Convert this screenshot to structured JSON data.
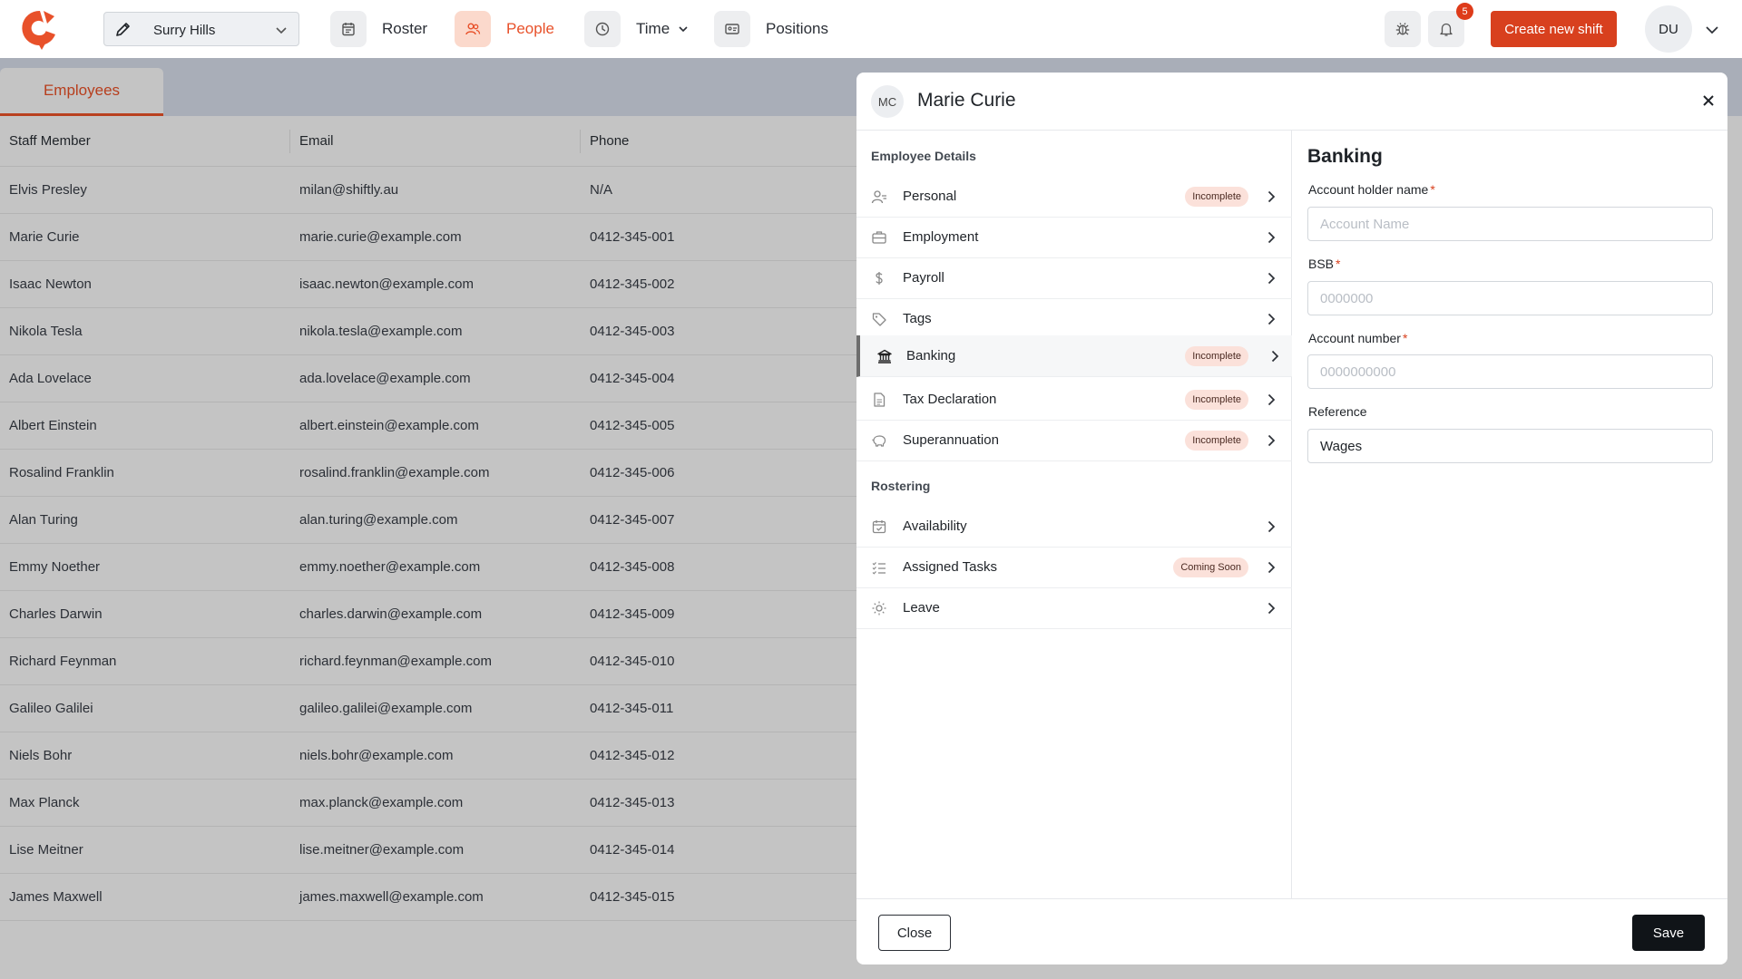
{
  "topbar": {
    "location": "Surry Hills",
    "nav": [
      {
        "label": "Roster",
        "icon": "calendar-icon",
        "active": false
      },
      {
        "label": "People",
        "icon": "people-icon",
        "active": true
      },
      {
        "label": "Time",
        "icon": "clock-icon",
        "active": false
      },
      {
        "label": "Positions",
        "icon": "id-card-icon",
        "active": false
      }
    ],
    "notification_count": "5",
    "create_label": "Create new shift",
    "user_initials": "DU"
  },
  "tabs": {
    "employees": "Employees"
  },
  "table": {
    "columns": [
      "Staff Member",
      "Email",
      "Phone"
    ],
    "rows": [
      [
        "Elvis Presley",
        "milan@shiftly.au",
        "N/A"
      ],
      [
        "Marie Curie",
        "marie.curie@example.com",
        "0412-345-001"
      ],
      [
        "Isaac Newton",
        "isaac.newton@example.com",
        "0412-345-002"
      ],
      [
        "Nikola Tesla",
        "nikola.tesla@example.com",
        "0412-345-003"
      ],
      [
        "Ada Lovelace",
        "ada.lovelace@example.com",
        "0412-345-004"
      ],
      [
        "Albert Einstein",
        "albert.einstein@example.com",
        "0412-345-005"
      ],
      [
        "Rosalind Franklin",
        "rosalind.franklin@example.com",
        "0412-345-006"
      ],
      [
        "Alan Turing",
        "alan.turing@example.com",
        "0412-345-007"
      ],
      [
        "Emmy Noether",
        "emmy.noether@example.com",
        "0412-345-008"
      ],
      [
        "Charles Darwin",
        "charles.darwin@example.com",
        "0412-345-009"
      ],
      [
        "Richard Feynman",
        "richard.feynman@example.com",
        "0412-345-010"
      ],
      [
        "Galileo Galilei",
        "galileo.galilei@example.com",
        "0412-345-011"
      ],
      [
        "Niels Bohr",
        "niels.bohr@example.com",
        "0412-345-012"
      ],
      [
        "Max Planck",
        "max.planck@example.com",
        "0412-345-013"
      ],
      [
        "Lise Meitner",
        "lise.meitner@example.com",
        "0412-345-014"
      ],
      [
        "James Maxwell",
        "james.maxwell@example.com",
        "0412-345-015"
      ]
    ]
  },
  "modal": {
    "initials": "MC",
    "name": "Marie Curie",
    "sections": {
      "employee_details": "Employee Details",
      "rostering": "Rostering"
    },
    "details_items": [
      {
        "label": "Personal",
        "status": "Incomplete",
        "icon": "person-icon"
      },
      {
        "label": "Employment",
        "status": "",
        "icon": "briefcase-icon"
      },
      {
        "label": "Payroll",
        "status": "",
        "icon": "dollar-icon"
      },
      {
        "label": "Tags",
        "status": "",
        "icon": "tag-icon"
      },
      {
        "label": "Banking",
        "status": "Incomplete",
        "icon": "bank-icon",
        "active": true
      },
      {
        "label": "Tax Declaration",
        "status": "Incomplete",
        "icon": "document-icon"
      },
      {
        "label": "Superannuation",
        "status": "Incomplete",
        "icon": "piggy-bank-icon"
      }
    ],
    "rostering_items": [
      {
        "label": "Availability",
        "status": "",
        "icon": "calendar-check-icon"
      },
      {
        "label": "Assigned Tasks",
        "status": "Coming Soon",
        "icon": "checklist-icon"
      },
      {
        "label": "Leave",
        "status": "",
        "icon": "sun-icon"
      }
    ],
    "banking": {
      "title": "Banking",
      "account_holder_label": "Account holder name",
      "account_holder_placeholder": "Account Name",
      "account_holder_value": "",
      "bsb_label": "BSB",
      "bsb_placeholder": "0000000",
      "bsb_value": "",
      "account_number_label": "Account number",
      "account_number_placeholder": "0000000000",
      "account_number_value": "",
      "reference_label": "Reference",
      "reference_value": "Wages",
      "required_mark": "*"
    },
    "close_label": "Close",
    "save_label": "Save"
  },
  "colors": {
    "accent": "#d8401e",
    "active_nav_text": "#e8512a",
    "overlay_bg": "#c4c4c4",
    "save_button": "#101418"
  }
}
